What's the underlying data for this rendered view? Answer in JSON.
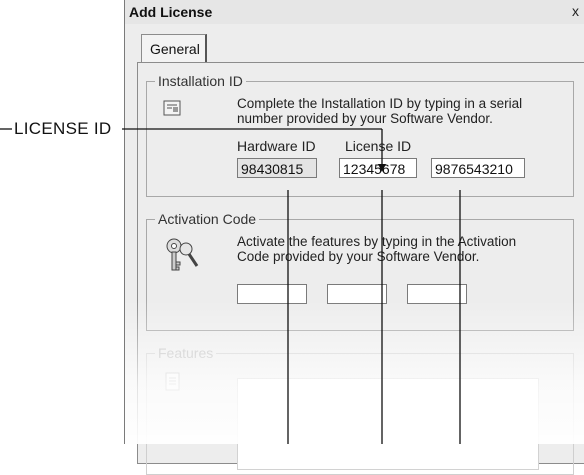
{
  "dialog": {
    "title": "Add License",
    "close_label": "x",
    "tabs": [
      {
        "label": "General"
      }
    ],
    "installation": {
      "legend": "Installation ID",
      "description_line1": "Complete the Installation ID by typing in a serial",
      "description_line2": "number provided by your Software Vendor.",
      "hardware_label": "Hardware ID",
      "license_label": "License ID",
      "hardware_value": "98430815",
      "license_value": "12345678",
      "third_value": "9876543210"
    },
    "activation": {
      "legend": "Activation Code",
      "description_line1": "Activate the features by typing in the Activation",
      "description_line2": "Code provided by your Software Vendor.",
      "code_values": [
        "",
        "",
        ""
      ]
    },
    "features": {
      "legend": "Features"
    }
  },
  "callout": {
    "label": "LICENSE ID"
  },
  "icons": {
    "installation": "license-file-icon",
    "activation": "keys-icon",
    "features": "document-icon"
  }
}
